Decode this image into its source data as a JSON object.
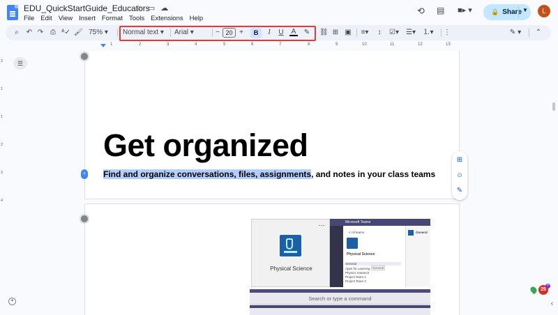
{
  "document": {
    "title": "EDU_QuickStartGuide_Educators"
  },
  "menu": {
    "items": [
      "File",
      "Edit",
      "View",
      "Insert",
      "Format",
      "Tools",
      "Extensions",
      "Help"
    ]
  },
  "share": {
    "label": "Share"
  },
  "user": {
    "avatar_initial": "L",
    "avatar_color": "#c5501a"
  },
  "toolbar": {
    "zoom": "75%",
    "style": "Normal text",
    "font": "Arial",
    "font_size": "20",
    "bold": "B",
    "italic": "I",
    "underline": "U",
    "text_color": "A",
    "highlight_color": "#e53935"
  },
  "ruler": {
    "numbers": [
      "1",
      "2",
      "3",
      "4",
      "5",
      "6",
      "7",
      "8",
      "9",
      "10",
      "11",
      "12",
      "13"
    ],
    "vertical_numbers": [
      "2",
      "1",
      "1",
      "2",
      "3",
      "4"
    ]
  },
  "content": {
    "heading": "Get organized",
    "subline_selected": "Find and organize conversations, files, assignments",
    "subline_rest": ", and notes in your class teams"
  },
  "image_card": {
    "label": "Physical Science",
    "more": "⋯"
  },
  "teams_screenshot": {
    "app_title": "Microsoft Teams",
    "back_link": "< All teams",
    "team_name": "Physical Science",
    "channel_header": "General",
    "channels": [
      "General",
      "Apps for Learning",
      "Physics research",
      "Project Team 1",
      "Project Team 2"
    ],
    "tooltip": "General",
    "command_placeholder": "Search or type a command"
  },
  "extensions": {
    "badge_count": "25"
  },
  "colors": {
    "accent": "#0b57d0",
    "share_bg": "#c2e7ff",
    "selection": "#b3cefb",
    "teams_purple": "#464775"
  }
}
